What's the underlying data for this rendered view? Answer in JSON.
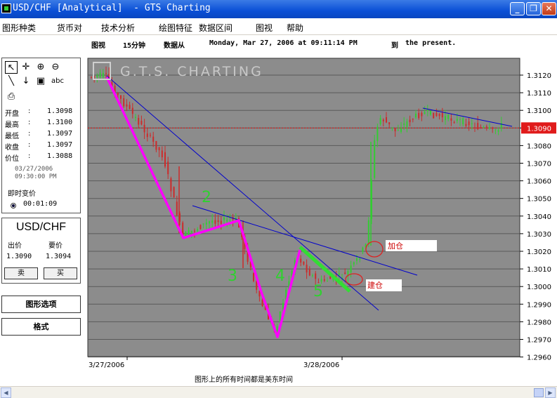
{
  "window": {
    "title": "USD/CHF [Analytical]  - GTS Charting",
    "minimize_glyph": "_",
    "restore_glyph": "❐",
    "close_glyph": "✕"
  },
  "menu": [
    {
      "label": "图形种类"
    },
    {
      "label": "货币对"
    },
    {
      "label": "技术分析"
    },
    {
      "label": "绘图特征"
    },
    {
      "label": "数据区间"
    },
    {
      "label": "图视"
    },
    {
      "label": "帮助"
    }
  ],
  "info": {
    "view_label": "图视",
    "interval": "15分钟",
    "data_from_label": "数据从",
    "datetime": "Monday, Mar 27, 2006 at 09:11:14 PM",
    "to_label": "到",
    "present": "the present."
  },
  "tools": {
    "text_tool_label": "abc"
  },
  "quote": {
    "rows": [
      {
        "label": "开盘",
        "colon": ":",
        "value": "1.3098"
      },
      {
        "label": "最高",
        "colon": ":",
        "value": "1.3100"
      },
      {
        "label": "最低",
        "colon": ":",
        "value": "1.3097"
      },
      {
        "label": "收盘",
        "colon": ":",
        "value": "1.3097"
      },
      {
        "label": "价位",
        "colon": ":",
        "value": "1.3088"
      }
    ],
    "date": "03/27/2006",
    "time": "09:30:00 PM",
    "realtime_label": "即时变价",
    "timer": "00:01:09"
  },
  "pair": {
    "name": "USD/CHF",
    "bid_label": "出价",
    "ask_label": "要价",
    "bid": "1.3090",
    "ask": "1.3094",
    "sell_label": "卖",
    "buy_label": "买"
  },
  "side_buttons": {
    "chart_options": "图形选项",
    "format": "格式"
  },
  "chart_data": {
    "type": "candlestick",
    "watermark": "G.T.S. CHARTING",
    "y_ticks": [
      "1.3120",
      "1.3110",
      "1.3100",
      "1.3090",
      "1.3080",
      "1.3070",
      "1.3060",
      "1.3050",
      "1.3040",
      "1.3030",
      "1.3020",
      "1.3010",
      "1.3000",
      "1.2990",
      "1.2980",
      "1.2970",
      "1.2960"
    ],
    "ylim": [
      1.296,
      1.3125
    ],
    "x_ticks": [
      "3/27/2006",
      "3/28/2006"
    ],
    "current_price_label": "1.3090",
    "current_price": 1.309,
    "annotations": [
      {
        "text": "加仓"
      },
      {
        "text": "建仓"
      }
    ],
    "handwritten": [
      "2",
      "3",
      "4",
      "5"
    ],
    "colors": {
      "background": "#8c8c8c",
      "up": "#33cc33",
      "down": "#cc2b2b",
      "trendline": "#0000cc",
      "wave": "#ff00ff",
      "highlight": "#33dd33",
      "price_line": "#ff0000"
    }
  },
  "footer": {
    "note": "图形上的所有时间都是美东时间"
  }
}
